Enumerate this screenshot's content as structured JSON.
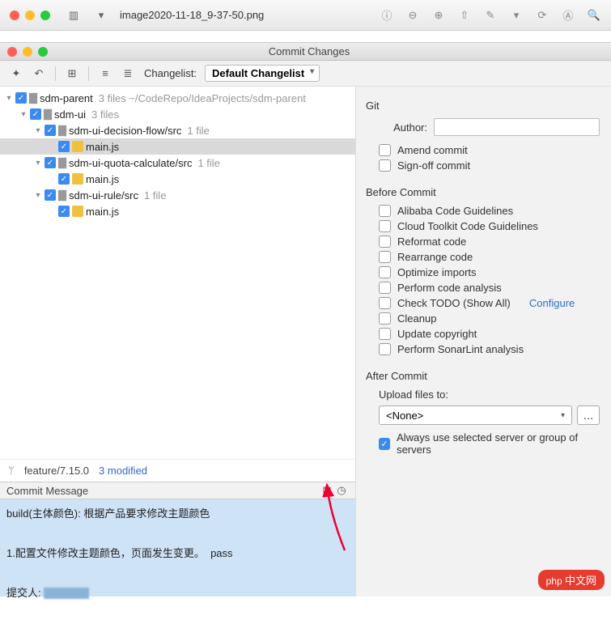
{
  "titlebar": {
    "filename": "image2020-11-18_9-37-50.png"
  },
  "dialog": {
    "title": "Commit Changes"
  },
  "toolbar": {
    "changelist_label": "Changelist:",
    "changelist_value": "Default Changelist"
  },
  "tree": {
    "root": {
      "name": "sdm-parent",
      "meta": "3 files  ~/CodeRepo/IdeaProjects/sdm-parent"
    },
    "n1": {
      "name": "sdm-ui",
      "meta": "3 files"
    },
    "n2": {
      "name": "sdm-ui-decision-flow/src",
      "meta": "1 file"
    },
    "f1": {
      "name": "main.js"
    },
    "n3": {
      "name": "sdm-ui-quota-calculate/src",
      "meta": "1 file"
    },
    "f2": {
      "name": "main.js"
    },
    "n4": {
      "name": "sdm-ui-rule/src",
      "meta": "1 file"
    },
    "f3": {
      "name": "main.js"
    }
  },
  "branch": {
    "name": "feature/7.15.0",
    "modified": "3 modified"
  },
  "commit_section": {
    "title": "Commit Message"
  },
  "commit_message": "build(主体颜色): 根据产品要求修改主题颜色\n\n1.配置文件修改主题颜色，页面发生变更。  pass\n\n提交人: ",
  "git": {
    "title": "Git",
    "author_label": "Author:",
    "amend": "Amend commit",
    "signoff": "Sign-off commit"
  },
  "before": {
    "title": "Before Commit",
    "items": [
      "Alibaba Code Guidelines",
      "Cloud Toolkit Code Guidelines",
      "Reformat code",
      "Rearrange code",
      "Optimize imports",
      "Perform code analysis",
      "Check TODO (Show All)",
      "Cleanup",
      "Update copyright",
      "Perform SonarLint analysis"
    ],
    "configure": "Configure"
  },
  "after": {
    "title": "After Commit",
    "upload_label": "Upload files to:",
    "upload_value": "<None>",
    "always": "Always use selected server or group of servers"
  },
  "watermark": "中文网"
}
